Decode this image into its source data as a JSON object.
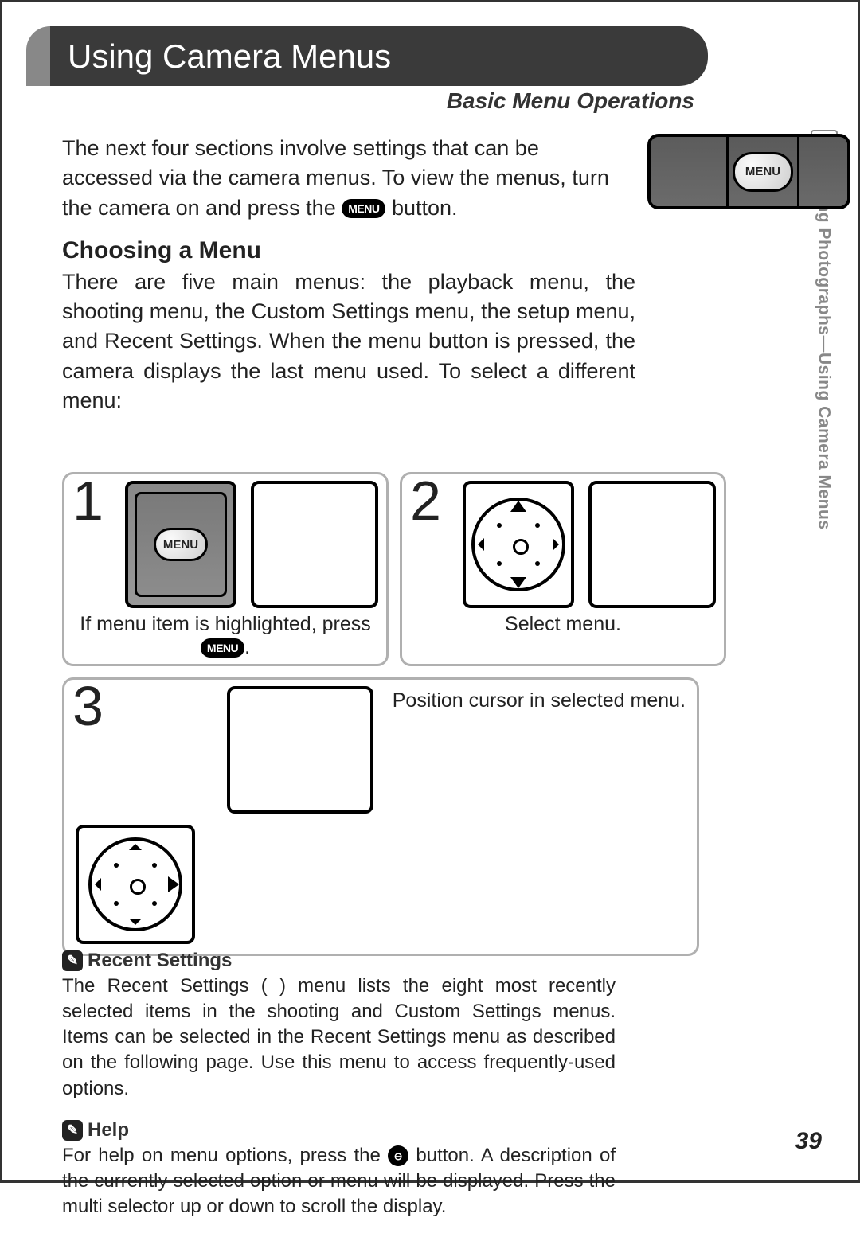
{
  "header": {
    "title": "Using Camera Menus",
    "subtitle": "Basic Menu Operations"
  },
  "side_tab": "Taking Photographs—Using Camera Menus",
  "intro": {
    "line1": "The next four sections involve settings that can be accessed via the camera menus.  To view the menus, turn the camera on and press the ",
    "line2": " button."
  },
  "menu_button_label": "MENU",
  "choosing": {
    "heading": "Choosing a Menu",
    "body": "There are five main menus: the playback menu, the shooting menu, the Custom Settings menu, the setup menu, and Recent Settings.  When the menu button is pressed, the camera displays the last menu used.  To select a different menu:"
  },
  "steps": {
    "s1": {
      "num": "1",
      "caption_a": "If menu item is highlighted, press ",
      "caption_b": "."
    },
    "s2": {
      "num": "2",
      "caption": "Select menu."
    },
    "s3": {
      "num": "3",
      "caption": "Position cursor in selected menu."
    }
  },
  "notes": {
    "recent": {
      "heading": "Recent Settings",
      "body": "The Recent Settings (   ) menu lists the eight most recently selected items in the shooting and Custom Settings menus.  Items can be selected in the Recent Settings menu as described on the following page.  Use this menu to access frequently-used options."
    },
    "help": {
      "heading": "Help",
      "body_a": "For help on menu options, press the ",
      "body_b": " button.  A description of the currently selected option or menu will be displayed.  Press the multi selector up or down to scroll the display."
    }
  },
  "page_number": "39"
}
